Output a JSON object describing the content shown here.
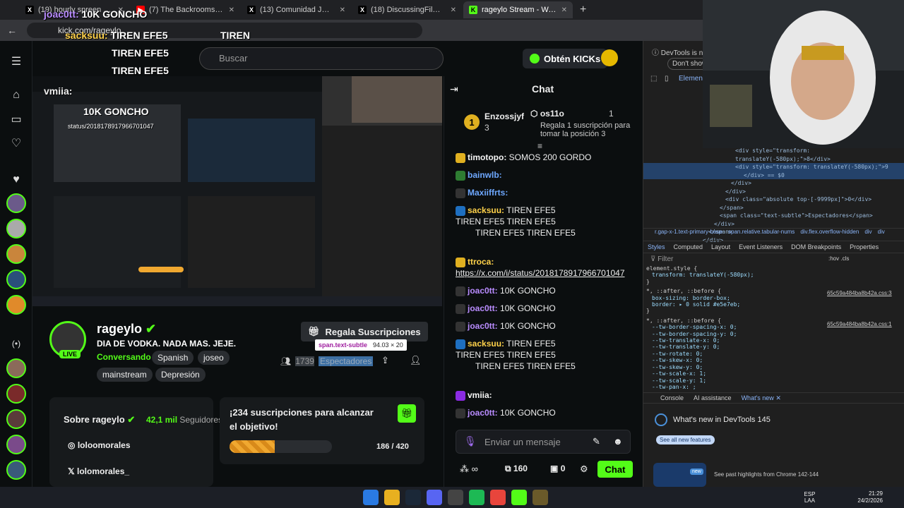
{
  "browser": {
    "tabs": [
      {
        "title": "(19) hourly spreen en X: \"https:...",
        "active": false,
        "fav": "X"
      },
      {
        "title": "(7) The Backrooms (Found Foota...",
        "active": false,
        "fav": "▶"
      },
      {
        "title": "(13) Comunidad JOSEO EXCLUS...",
        "active": false,
        "fav": "X"
      },
      {
        "title": "(18) DiscussingFilm en X: \"First...",
        "active": false,
        "fav": "X"
      },
      {
        "title": "rageylo Stream - Watch Live on...",
        "active": true,
        "fav": "K"
      }
    ],
    "url": "kick.com/rageylo"
  },
  "overlay_chat": {
    "line1_user": "joac0tt:",
    "line1_text": "10K GONCHO",
    "line2_user": "sacksuu:",
    "line2_text": "TIREN EFE5",
    "line3": "TIREN",
    "line4_text": "TIREN EFE5",
    "line5_text": "TIREN EFE5",
    "line6_user": "vmiia:",
    "line7_text": "10K GONCHO",
    "line8": "status/2018178917966701047"
  },
  "header": {
    "search_placeholder": "Buscar",
    "get_kicks": "Obtén KICKs"
  },
  "channel": {
    "name": "rageylo",
    "title": "DIA DE VODKA. NADA MAS. JEJE.",
    "category": "Conversando",
    "tags": [
      "Spanish",
      "joseo",
      "mainstream",
      "Depresión"
    ],
    "live_label": "LIVE",
    "gift_subs": "Regala Suscripciones",
    "tooltip_el": "span.text-subtle",
    "tooltip_size": "94.03 × 20",
    "viewer_count": "1739",
    "viewer_label": "Espectadores"
  },
  "about": {
    "title": "Sobre rageylo",
    "followers_count": "42,1 mil",
    "followers_label": "Seguidores",
    "instagram": "loloomorales",
    "x": "lolomorales_"
  },
  "goal": {
    "text": "¡234 suscripciones para alcanzar el objetivo!",
    "current": "186",
    "target": "420",
    "progress_fraction": 0.443
  },
  "chat": {
    "title": "Chat",
    "top1_user": "Enzossjyf",
    "top1_count": "3",
    "top2_user": "os11o",
    "top2_rank": "1",
    "top2_text": "Regala 1 suscripción para tomar la posición 3",
    "messages": [
      {
        "user": "timotopo:",
        "color": "#f5f5f5",
        "text": "SOMOS 200 GORDO"
      },
      {
        "user": "bainwlb:",
        "color": "#6ea8ff",
        "text": ""
      },
      {
        "user": "Maxiiffrts:",
        "color": "#6ea8ff",
        "text": ""
      },
      {
        "user": "sacksuu:",
        "color": "#ffd24a",
        "text": "TIREN EFE5"
      },
      {
        "user": "",
        "color": "#fff",
        "text": "TIREN EFE5       TIREN EFE5"
      },
      {
        "user": "",
        "color": "#fff",
        "text": "TIREN EFE5       TIREN EFE5"
      },
      {
        "user": "ttroca:",
        "color": "#ffd24a",
        "text": ""
      },
      {
        "user": "",
        "color": "#fff",
        "text": "https://x.com/i/status/2018178917966701047"
      },
      {
        "user": "joac0tt:",
        "color": "#b98cff",
        "text": "10K GONCHO"
      },
      {
        "user": "joac0tt:",
        "color": "#b98cff",
        "text": "10K GONCHO"
      },
      {
        "user": "joac0tt:",
        "color": "#b98cff",
        "text": "10K GONCHO"
      },
      {
        "user": "sacksuu:",
        "color": "#ffd24a",
        "text": "TIREN EFE5"
      },
      {
        "user": "",
        "color": "#fff",
        "text": "TIREN EFE5       TIREN EFE5"
      },
      {
        "user": "",
        "color": "#fff",
        "text": "TIREN EFE5       TIREN EFE5"
      },
      {
        "user": "vmiia:",
        "color": "#f5f5f5",
        "text": ""
      },
      {
        "user": "joac0tt:",
        "color": "#b98cff",
        "text": "10K GONCHO"
      }
    ],
    "input_placeholder": "Enviar un mensaje",
    "kicks_balance": "160",
    "points": "0",
    "send_label": "Chat"
  },
  "devtools": {
    "notice": "DevTools is n",
    "dont_show": "Don't show",
    "elements_tab": "Elements",
    "code_lines": [
      "<div style=\"transform: translateY(-580px);\">8</div>",
      "<div style=\"transform: translateY(-580px);\">9",
      "</div> == $0",
      "</div>",
      "</div>",
      "<div class=\"absolute top-[-9999px]\">0</div>",
      "</span>",
      "<span class=\"text-subtle\">Espectadores</span>",
      "</div>",
      "</span>",
      "</div>"
    ],
    "breadcrumbs": [
      "r.gap-x-1.text-primary-base",
      "span.relative.tabular-nums",
      "div.flex.overflow-hidden",
      "div",
      "div"
    ],
    "tabs": [
      "Styles",
      "Computed",
      "Layout",
      "Event Listeners",
      "DOM Breakpoints",
      "Properties"
    ],
    "filter": "Filter",
    "filter_right": ":hov .cls",
    "styles": [
      "element.style {",
      "  transform: translateY(-580px);",
      "}",
      "*, ::after, ::before {",
      "  box-sizing: border-box;",
      "  border: ▸ 0 solid #e5e7eb;",
      "}",
      "*, ::after, ::before {",
      "  --tw-border-spacing-x: 0;",
      "  --tw-border-spacing-y: 0;",
      "  --tw-translate-x: 0;",
      "  --tw-translate-y: 0;",
      "  --tw-rotate: 0;",
      "  --tw-skew-x: 0;",
      "  --tw-skew-y: 0;",
      "  --tw-scale-x: 1;",
      "  --tw-scale-y: 1;",
      "  --tw-pan-x: ;"
    ],
    "css_ref1": "65c59a484ba8b42a.css:3",
    "css_ref2": "65c59a484ba8b42a.css:1",
    "drawer_tabs": [
      "Console",
      "AI assistance",
      "What's new"
    ],
    "whats_new_title": "What's new in DevTools 145",
    "see_all": "See all new features",
    "highlights": "See past highlights from Chrome 142-144",
    "new_badge": "new"
  },
  "taskbar": {
    "lang1": "ESP",
    "lang2": "LAA",
    "time": "21:29",
    "date": "24/2/2026"
  },
  "colors": {
    "kick_green": "#53fc18",
    "bg": "#0b0e0f"
  }
}
